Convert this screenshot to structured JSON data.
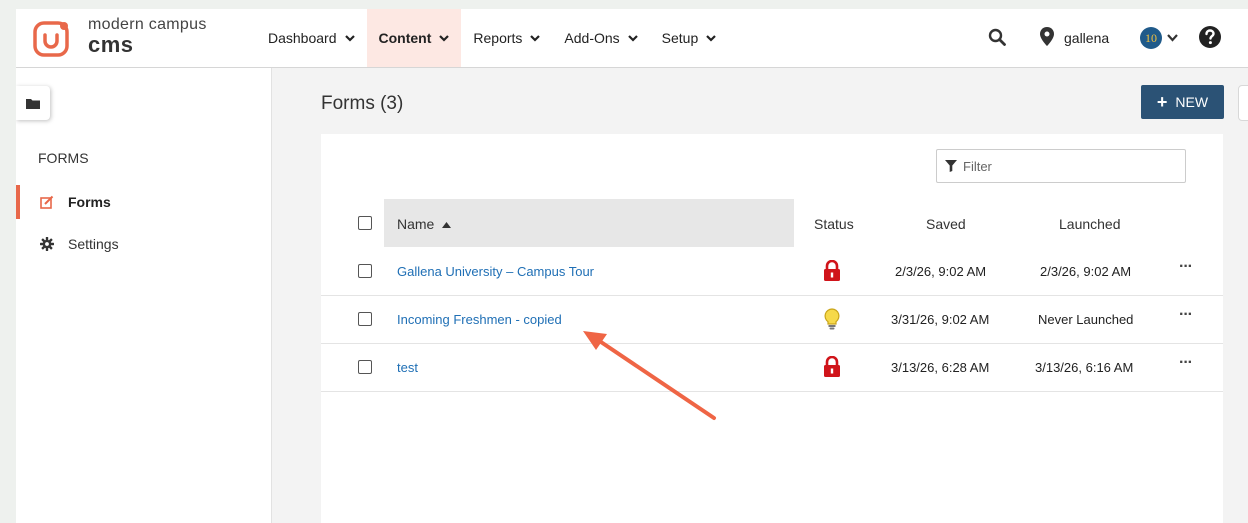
{
  "brand": {
    "line1": "modern campus",
    "line2": "cms",
    "accent_color": "#e8684a"
  },
  "nav": {
    "items": [
      {
        "label": "Dashboard"
      },
      {
        "label": "Content"
      },
      {
        "label": "Reports"
      },
      {
        "label": "Add-Ons"
      },
      {
        "label": "Setup"
      }
    ],
    "active": "Content"
  },
  "user": {
    "name": "gallena",
    "badge_count": "10"
  },
  "sidebar": {
    "heading": "FORMS",
    "items": [
      {
        "label": "Forms",
        "icon": "edit-icon"
      },
      {
        "label": "Settings",
        "icon": "gear-icon"
      }
    ]
  },
  "main": {
    "title": "Forms (3)",
    "new_label": "NEW",
    "filter_placeholder": "Filter",
    "columns": {
      "name": "Name",
      "status": "Status",
      "saved": "Saved",
      "launched": "Launched"
    },
    "rows": [
      {
        "name": "Gallena University – Campus Tour",
        "status": "locked",
        "saved": "2/3/26, 9:02 AM",
        "launched": "2/3/26, 9:02 AM",
        "more": "···"
      },
      {
        "name": "Incoming Freshmen - copied",
        "status": "draft-lightbulb",
        "saved": "3/31/26, 9:02 AM",
        "launched": "Never Launched",
        "more": "···"
      },
      {
        "name": "test",
        "status": "locked",
        "saved": "3/13/26, 6:28 AM",
        "launched": "3/13/26, 6:16 AM",
        "more": "···"
      }
    ]
  },
  "annotation": {
    "arrow_color": "#ef6545"
  }
}
